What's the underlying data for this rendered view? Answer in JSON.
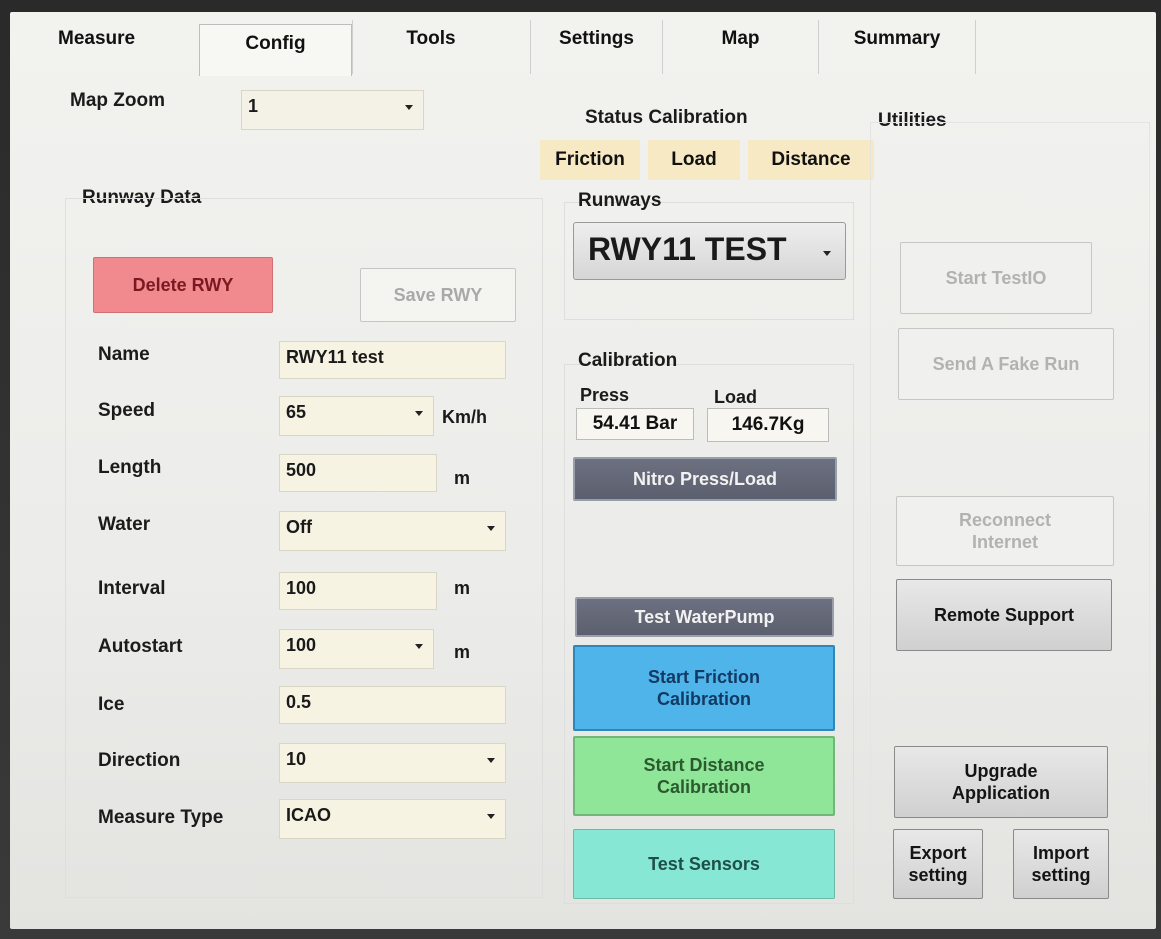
{
  "tabs": [
    {
      "label": "Measure"
    },
    {
      "label": "Config"
    },
    {
      "label": "Tools"
    },
    {
      "label": "Settings"
    },
    {
      "label": "Map"
    },
    {
      "label": "Summary"
    }
  ],
  "map_zoom": {
    "label": "Map Zoom",
    "value": "1"
  },
  "runway_data": {
    "title": "Runway Data",
    "delete_label": "Delete RWY",
    "save_label": "Save RWY",
    "fields": {
      "name": {
        "label": "Name",
        "value": "RWY11 test"
      },
      "speed": {
        "label": "Speed",
        "value": "65",
        "unit": "Km/h"
      },
      "length": {
        "label": "Length",
        "value": "500",
        "unit": "m"
      },
      "water": {
        "label": "Water",
        "value": "Off"
      },
      "interval": {
        "label": "Interval",
        "value": "100",
        "unit": "m"
      },
      "autostart": {
        "label": "Autostart",
        "value": "100",
        "unit": "m"
      },
      "ice": {
        "label": "Ice",
        "value": "0.5"
      },
      "direction": {
        "label": "Direction",
        "value": "10"
      },
      "measure_type": {
        "label": "Measure Type",
        "value": "ICAO"
      }
    }
  },
  "status_calibration": {
    "title": "Status Calibration",
    "chips": [
      "Friction",
      "Load",
      "Distance"
    ]
  },
  "runways": {
    "label": "Runways",
    "selected": "RWY11 TEST"
  },
  "calibration": {
    "title": "Calibration",
    "press_label": "Press",
    "load_label": "Load",
    "press_value": "54.41 Bar",
    "load_value": "146.7Kg",
    "nitro_label": "Nitro Press/Load",
    "waterpump_label": "Test WaterPump",
    "friction_cal_line1": "Start Friction",
    "friction_cal_line2": "Calibration",
    "distance_cal_line1": "Start Distance",
    "distance_cal_line2": "Calibration",
    "sensors_label": "Test Sensors"
  },
  "utilities": {
    "title": "Utilities",
    "start_testio": "Start TestIO",
    "fake_run": "Send A Fake Run",
    "reconnect_line1": "Reconnect",
    "reconnect_line2": "Internet",
    "remote_support": "Remote Support",
    "upgrade_line1": "Upgrade",
    "upgrade_line2": "Application",
    "export_line1": "Export",
    "export_line2": "setting",
    "import_line1": "Import",
    "import_line2": "setting"
  },
  "colors": {
    "delete": "#f08a8f",
    "friction_cal": "#4fb4ea",
    "distance_cal": "#8fe598",
    "sensors": "#86e8d4",
    "status_chip": "#f7e9c4",
    "field_bg": "#f6f3e3"
  }
}
